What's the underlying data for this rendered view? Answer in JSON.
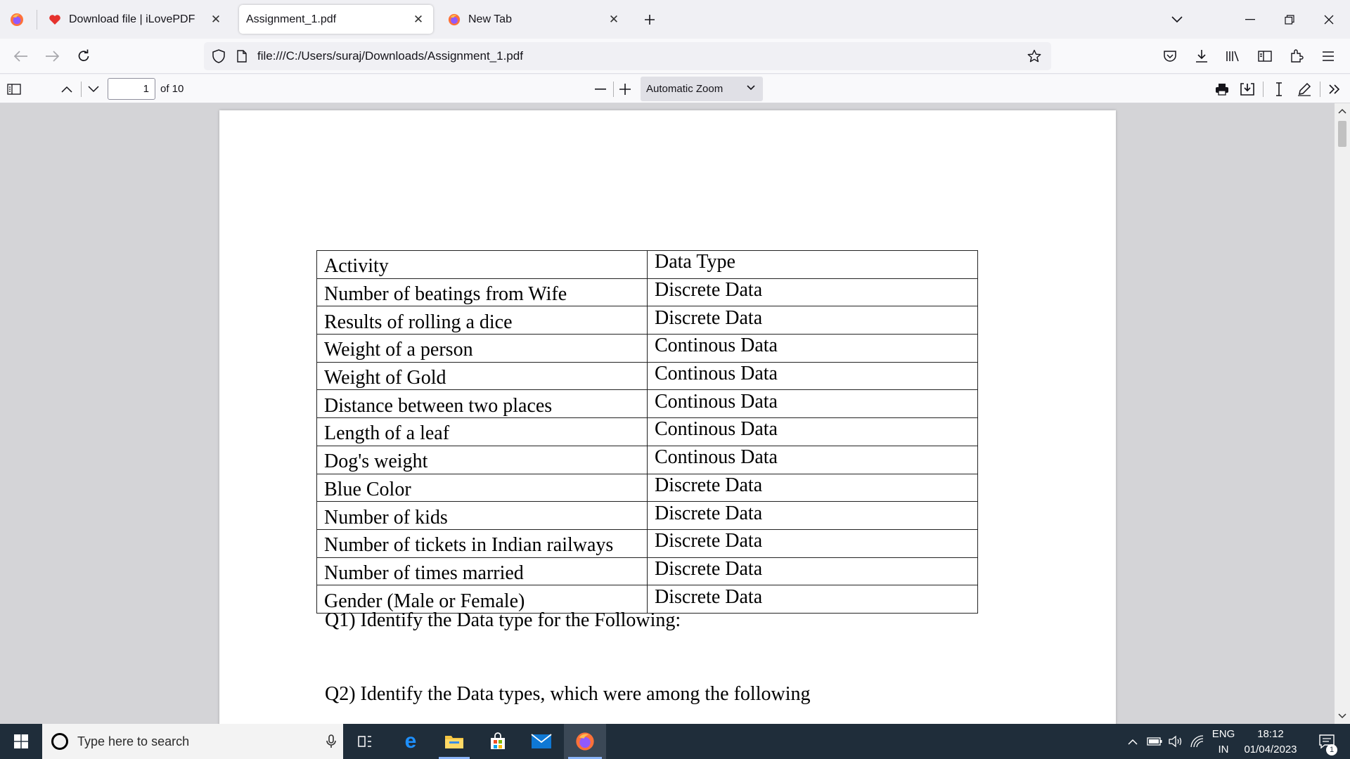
{
  "browser": {
    "tabs": [
      {
        "title": "Download file | iLovePDF",
        "active": false
      },
      {
        "title": "Assignment_1.pdf",
        "active": true
      },
      {
        "title": "New Tab",
        "active": false
      }
    ],
    "url": "file:///C:/Users/suraj/Downloads/Assignment_1.pdf"
  },
  "pdf_toolbar": {
    "page_number": "1",
    "page_count": "of 10",
    "zoom": "Automatic Zoom"
  },
  "document": {
    "table": [
      {
        "activity": "Activity",
        "type": "Data Type"
      },
      {
        "activity": "Number of beatings from Wife",
        "type": "Discrete Data"
      },
      {
        "activity": "Results of rolling a dice",
        "type": "Discrete Data"
      },
      {
        "activity": "Weight of a person",
        "type": "Continous Data"
      },
      {
        "activity": "Weight of Gold",
        "type": "Continous Data"
      },
      {
        "activity": "Distance between two places",
        "type": "Continous Data"
      },
      {
        "activity": "Length of a leaf",
        "type": "Continous Data"
      },
      {
        "activity": "Dog's weight",
        "type": "Continous Data"
      },
      {
        "activity": "Blue Color",
        "type": "Discrete Data"
      },
      {
        "activity": "Number of kids",
        "type": "Discrete Data"
      },
      {
        "activity": "Number of tickets in Indian railways",
        "type": "Discrete Data"
      },
      {
        "activity": "Number of times married",
        "type": "Discrete Data"
      },
      {
        "activity": "Gender (Male or Female)",
        "type": "Discrete Data"
      }
    ],
    "q1": "Q1) Identify the Data type for the Following:",
    "q2": "Q2) Identify the Data types, which were among the following"
  },
  "taskbar": {
    "search_placeholder": "Type here to search",
    "lang_top": "ENG",
    "lang_bottom": "IN",
    "time": "18:12",
    "date": "01/04/2023",
    "notification_count": "1"
  },
  "colors": {
    "accent": "#0060df",
    "taskbar": "#1f2d3a",
    "viewer_bg": "#d4d4d7"
  }
}
